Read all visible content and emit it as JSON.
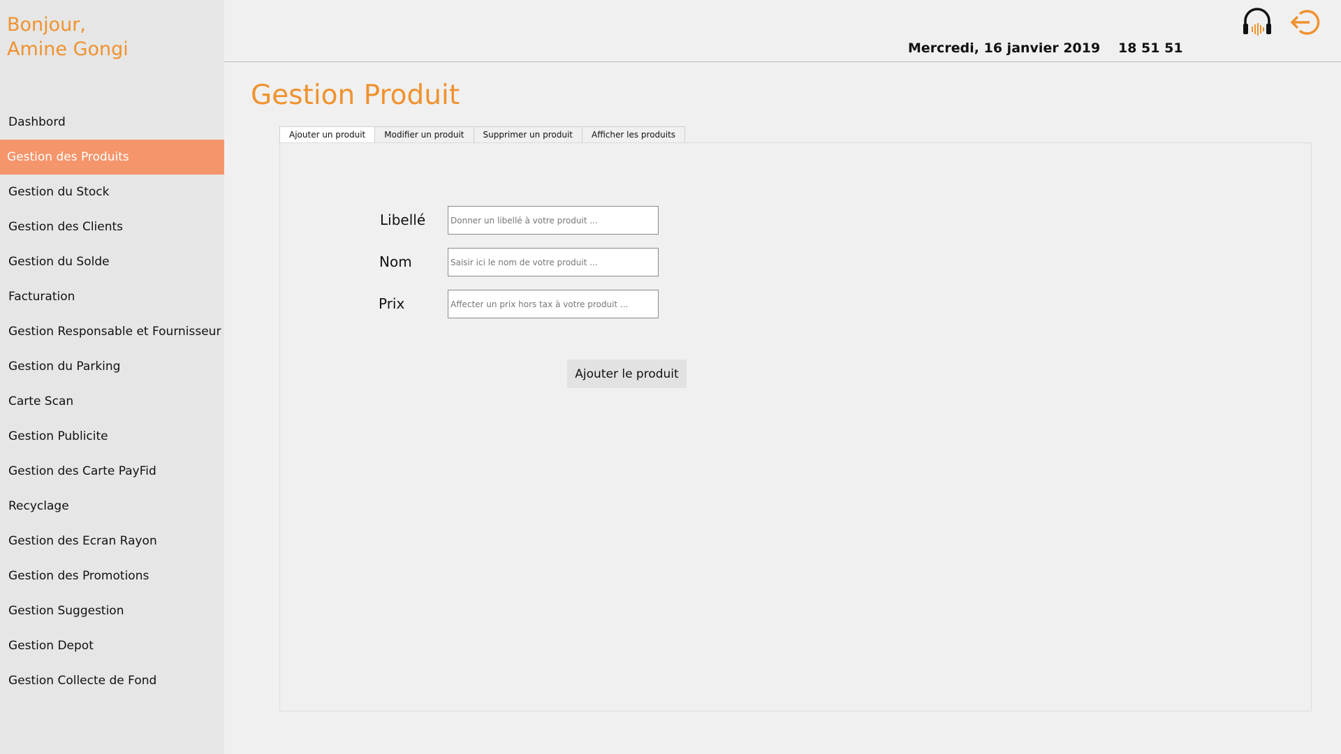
{
  "sidebar": {
    "greeting_line1": "Bonjour,",
    "greeting_line2": "Amine Gongi",
    "items": [
      {
        "label": "Dashbord"
      },
      {
        "label": "Gestion des Produits"
      },
      {
        "label": "Gestion du Stock"
      },
      {
        "label": "Gestion des Clients"
      },
      {
        "label": "Gestion du Solde"
      },
      {
        "label": "Facturation"
      },
      {
        "label": "Gestion Responsable et Fournisseur"
      },
      {
        "label": "Gestion du Parking"
      },
      {
        "label": "Carte Scan"
      },
      {
        "label": "Gestion Publicite"
      },
      {
        "label": "Gestion des Carte PayFid"
      },
      {
        "label": "Recyclage"
      },
      {
        "label": "Gestion des Ecran Rayon"
      },
      {
        "label": "Gestion des Promotions"
      },
      {
        "label": "Gestion Suggestion"
      },
      {
        "label": "Gestion Depot"
      },
      {
        "label": "Gestion Collecte de Fond"
      }
    ],
    "active_item": "Gestion des Produits"
  },
  "header": {
    "date": "Mercredi, 16 janvier 2019",
    "time": "18 51 51",
    "icons": [
      "headset-icon",
      "logout-icon"
    ]
  },
  "main": {
    "title": "Gestion Produit",
    "tabs": [
      {
        "label": "Ajouter un produit"
      },
      {
        "label": "Modifier un produit"
      },
      {
        "label": "Supprimer un produit"
      },
      {
        "label": "Afficher les produits"
      }
    ],
    "active_tab": "Ajouter un produit",
    "form": {
      "libelle_label": "Libellé",
      "libelle_placeholder": "Donner un libellé à votre produit ...",
      "nom_label": "Nom",
      "nom_placeholder": "Saisir ici le nom de votre produit ...",
      "prix_label": "Prix",
      "prix_placeholder": "Affecter un prix hors tax à votre produit ...",
      "submit_label": "Ajouter le produit"
    }
  },
  "colors": {
    "accent": "#f0922e",
    "active_nav": "#f5956b",
    "sidebar_bg": "#e6e6e6",
    "page_bg": "#f0f0f0"
  }
}
